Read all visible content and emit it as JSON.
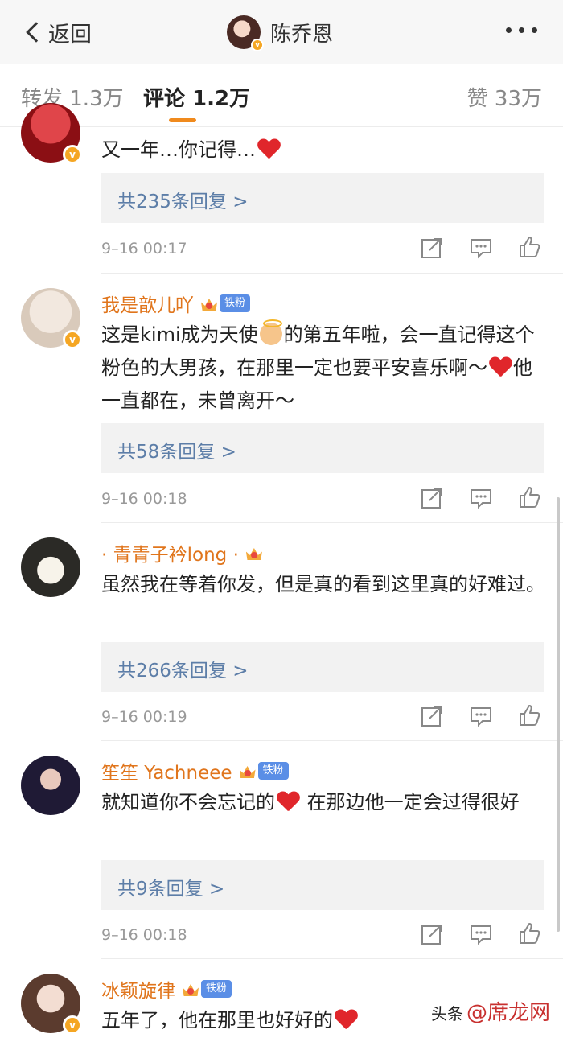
{
  "nav": {
    "back_label": "返回",
    "title": "陈乔恩"
  },
  "tabs": [
    {
      "label": "转发 1.3万"
    },
    {
      "label": "评论 1.2万"
    },
    {
      "label": "赞 33万"
    }
  ],
  "comments": [
    {
      "username": "",
      "text_parts": [
        "又一年…你记得…"
      ],
      "replies": "共235条回复 >",
      "time": "9–16 00:17"
    },
    {
      "username": "我是歆儿吖",
      "fan_badge": "铁粉",
      "text_parts": [
        "这是kimi成为天使",
        "的第五年啦，会一直记得这个粉色的大男孩，在那里一定也要平安喜乐啊～",
        "他一直都在，未曾离开～"
      ],
      "replies": "共58条回复 >",
      "time": "9–16 00:18"
    },
    {
      "username": "· 青青子衿long ·",
      "text_parts": [
        "虽然我在等着你发，但是真的看到这里真的好难过。"
      ],
      "replies": "共266条回复 >",
      "time": "9–16 00:19"
    },
    {
      "username": "笙笙 Yachneee",
      "fan_badge": "铁粉",
      "text_parts": [
        "就知道你不会忘记的",
        " 在那边他一定会过得很好"
      ],
      "replies": "共9条回复 >",
      "time": "9–16 00:18"
    },
    {
      "username": "冰颖旋律",
      "fan_badge": "铁粉",
      "text_parts": [
        "五年了，他在那里也好好的"
      ]
    }
  ],
  "watermark": {
    "prefix": "头条",
    "brand": "@席龙网"
  },
  "colors": {
    "accent_orange": "#e0751c",
    "link_blue": "#5d7ea8",
    "heart_red": "#e0262b"
  }
}
